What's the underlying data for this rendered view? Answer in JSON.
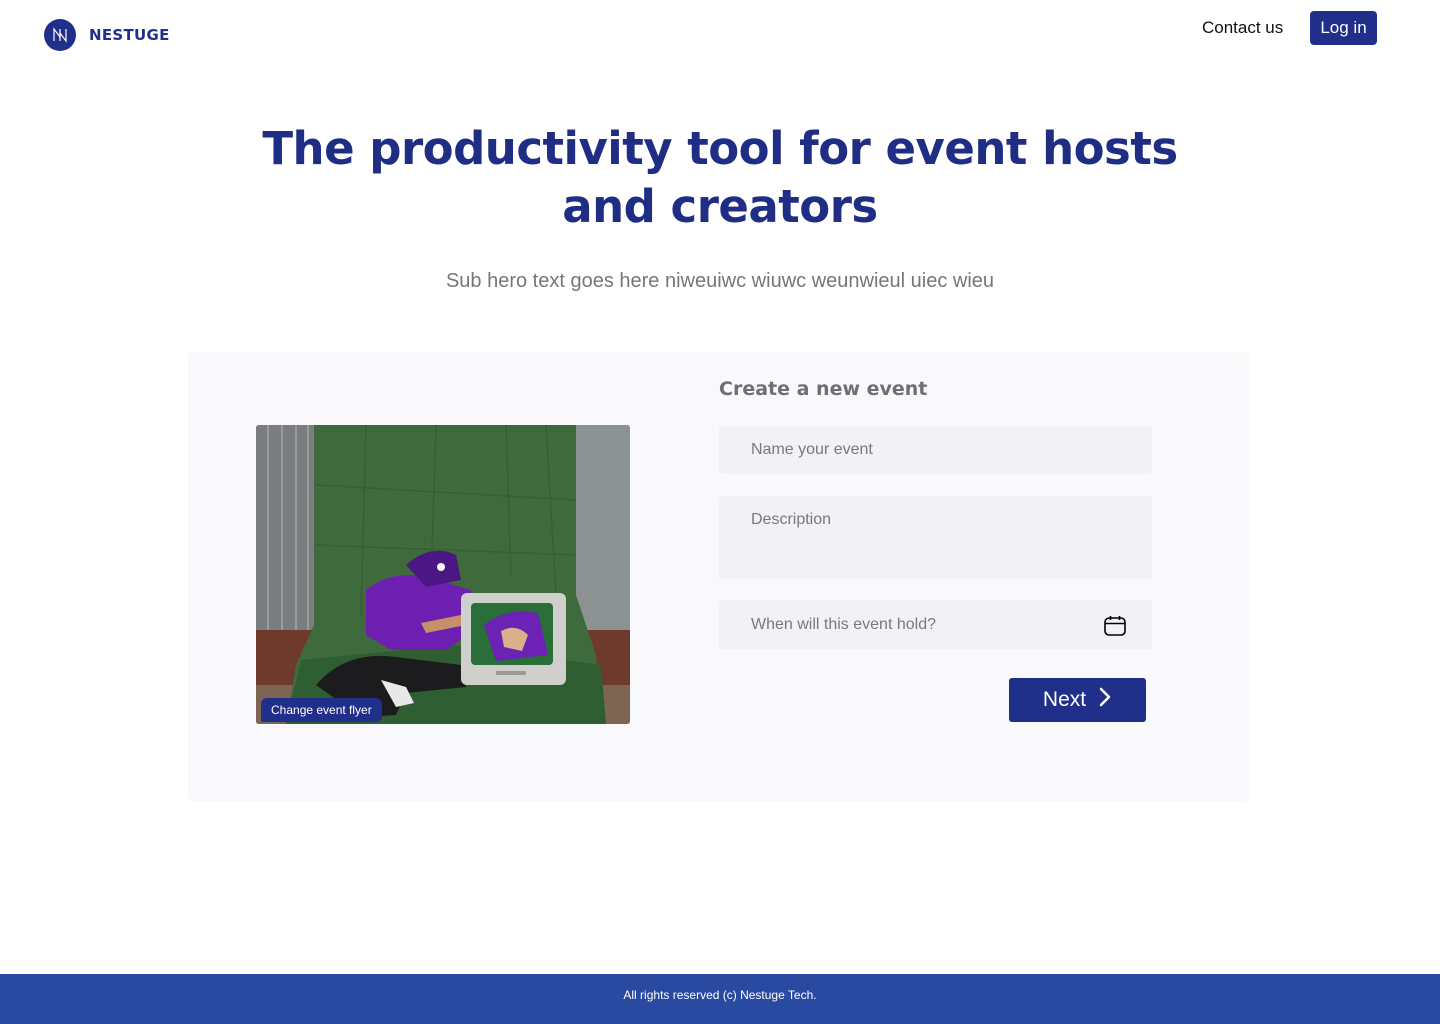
{
  "brand": {
    "name": "NESTUGE",
    "color": "#1f2f8a"
  },
  "nav": {
    "contact_label": "Contact us",
    "login_label": "Log in"
  },
  "hero": {
    "title": "The productivity tool for event hosts and creators",
    "subtitle": "Sub hero text goes here niweuiwc  wiuwc weunwieul uiec wieu"
  },
  "form": {
    "title": "Create a new event",
    "name_placeholder": "Name your event",
    "description_placeholder": "Description",
    "date_placeholder": "When will this event hold?",
    "date_icon": "calendar-icon",
    "next_label": "Next",
    "next_icon": "chevron-right-icon"
  },
  "flyer": {
    "change_label": "Change event flyer"
  },
  "footer": {
    "copyright": "All rights reserved (c) Nestuge Tech."
  },
  "colors": {
    "primary": "#1f2f8a",
    "footer": "#2a4aa1",
    "card": "#f9f9fb"
  }
}
